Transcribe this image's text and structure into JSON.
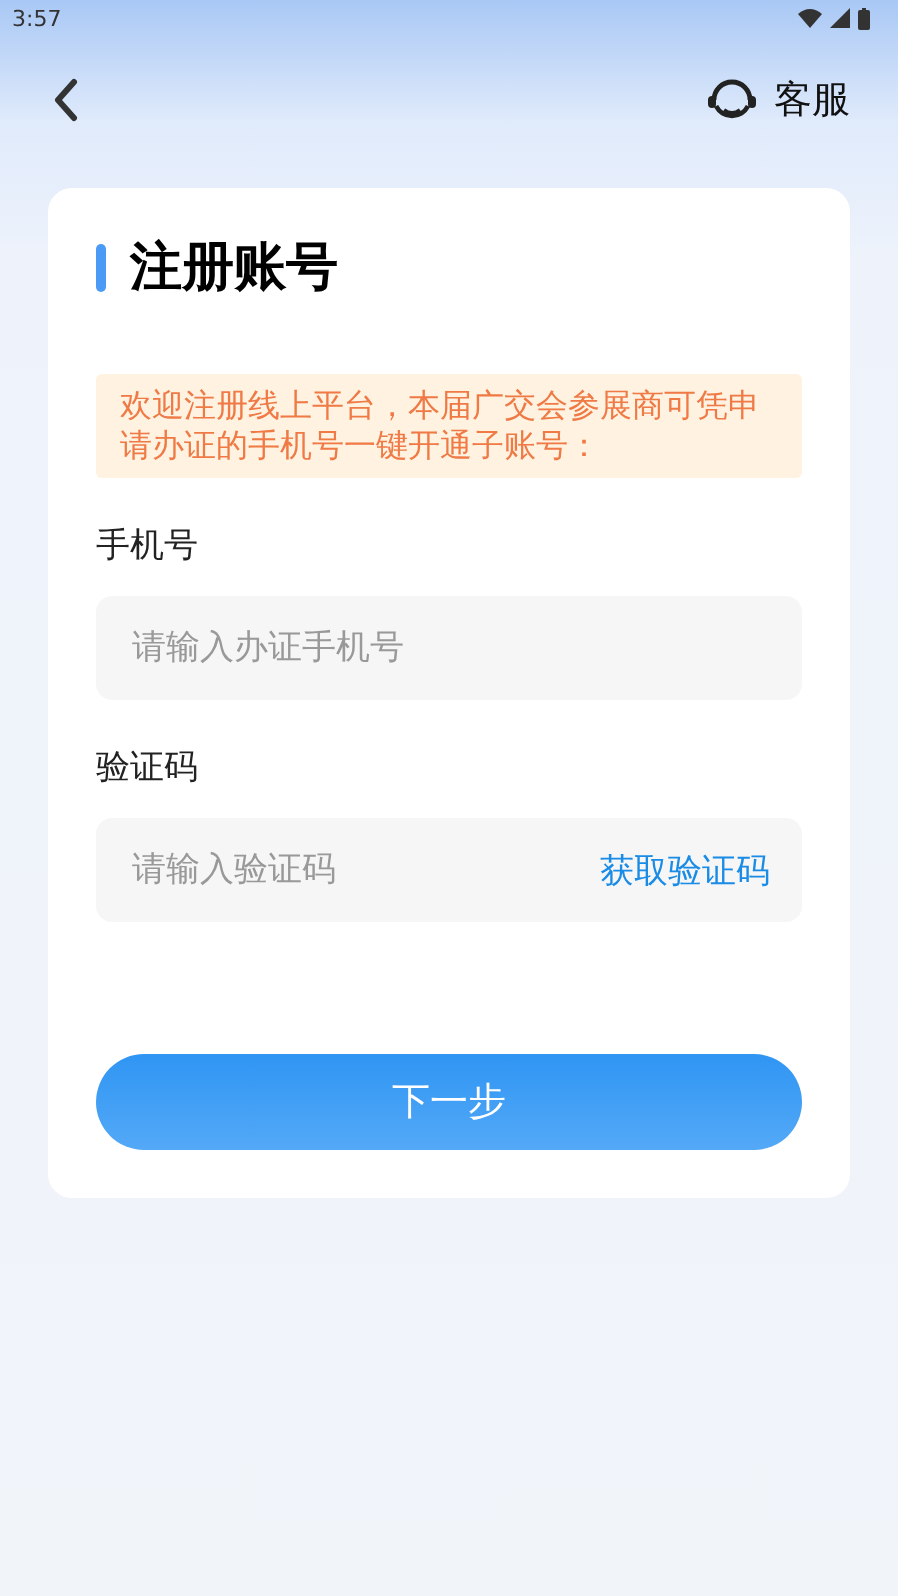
{
  "status_bar": {
    "time": "3:57"
  },
  "header": {
    "service_label": "客服"
  },
  "card": {
    "title": "注册账号",
    "notice": "欢迎注册线上平台，本届广交会参展商可凭申请办证的手机号一键开通子账号：",
    "fields": [
      {
        "kind": "plain",
        "label": "手机号",
        "placeholder": "请输入办证手机号"
      },
      {
        "kind": "code",
        "label": "验证码",
        "placeholder": "请输入验证码",
        "action": "获取验证码"
      }
    ],
    "submit": "下一步"
  }
}
